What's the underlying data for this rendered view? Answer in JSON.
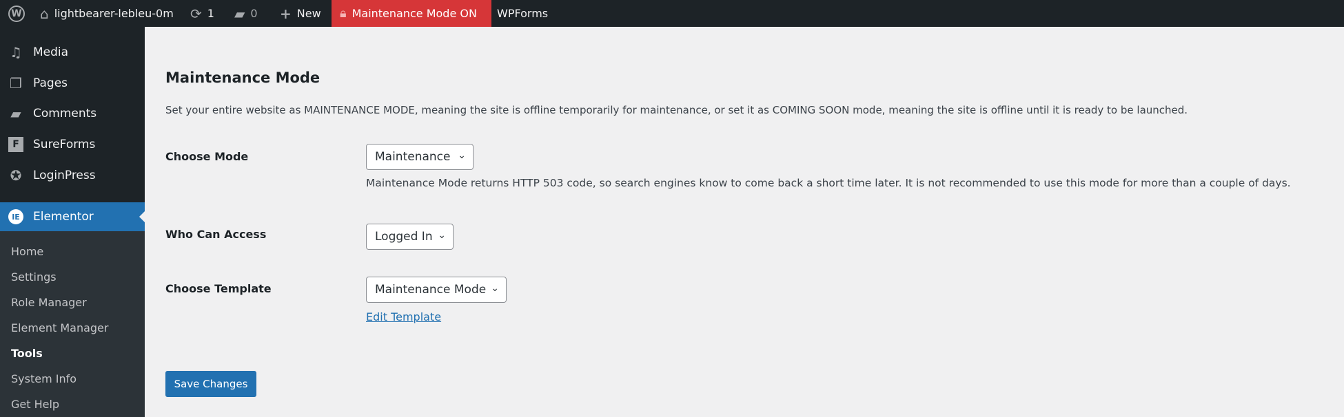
{
  "adminbar": {
    "site": "lightbearer-lebleu-0m",
    "updates": "1",
    "comments": "0",
    "new": "New",
    "maintenance": "Maintenance Mode ON",
    "wpforms": "WPForms"
  },
  "sidebar": {
    "items": [
      {
        "label": "Media",
        "icon": "media-icon"
      },
      {
        "label": "Pages",
        "icon": "pages-icon"
      },
      {
        "label": "Comments",
        "icon": "comments-icon"
      },
      {
        "label": "SureForms",
        "icon": "sureforms-icon"
      },
      {
        "label": "LoginPress",
        "icon": "loginpress-icon"
      },
      {
        "label": "Elementor",
        "icon": "elementor-icon"
      }
    ],
    "submenu": [
      "Home",
      "Settings",
      "Role Manager",
      "Element Manager",
      "Tools",
      "System Info",
      "Get Help"
    ],
    "current": "Tools"
  },
  "main": {
    "title": "Maintenance Mode",
    "description": "Set your entire website as MAINTENANCE MODE, meaning the site is offline temporarily for maintenance, or set it as COMING SOON mode, meaning the site is offline until it is ready to be launched.",
    "mode_label": "Choose Mode",
    "mode_value": "Maintenance",
    "mode_help": "Maintenance Mode returns HTTP 503 code, so search engines know to come back a short time later. It is not recommended to use this mode for more than a couple of days.",
    "access_label": "Who Can Access",
    "access_value": "Logged In",
    "template_label": "Choose Template",
    "template_value": "Maintenance Mode",
    "edit_template": "Edit Template",
    "save": "Save Changes"
  },
  "colors": {
    "accent": "#2271b1",
    "maintenance_badge": "#d63638",
    "adminbar": "#1d2327"
  }
}
